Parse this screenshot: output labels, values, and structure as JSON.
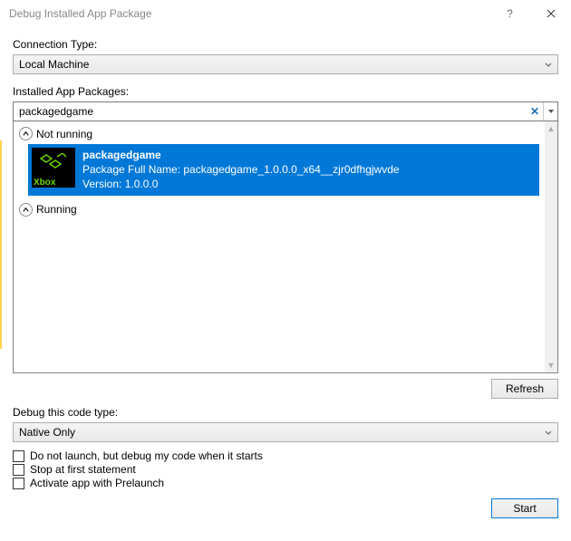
{
  "titlebar": {
    "title": "Debug Installed App Package"
  },
  "connection": {
    "label": "Connection Type:",
    "value": "Local Machine"
  },
  "installed": {
    "label": "Installed App Packages:",
    "filter_value": "packagedgame",
    "groups": {
      "not_running": "Not running",
      "running": "Running"
    },
    "selected_pkg": {
      "name": "packagedgame",
      "full_name_line": "Package Full Name: packagedgame_1.0.0.0_x64__zjr0dfhgjwvde",
      "version_line": "Version: 1.0.0.0",
      "thumb_label": "Xbox"
    }
  },
  "buttons": {
    "refresh": "Refresh",
    "start": "Start"
  },
  "codetype": {
    "label": "Debug this code type:",
    "value": "Native Only"
  },
  "checks": {
    "c1": "Do not launch, but debug my code when it starts",
    "c2": "Stop at first statement",
    "c3": "Activate app with Prelaunch"
  }
}
